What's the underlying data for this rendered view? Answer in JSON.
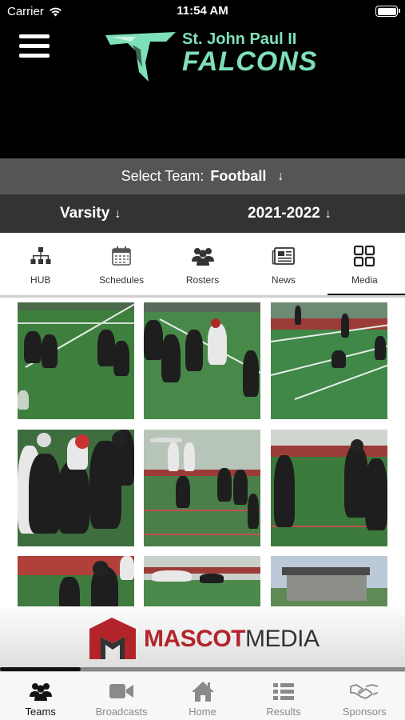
{
  "status_bar": {
    "carrier": "Carrier",
    "time": "11:54 AM"
  },
  "header": {
    "logo_school": "St. John Paul II",
    "logo_team": "FALCONS",
    "accent_color": "#7ee0b8"
  },
  "select_team": {
    "label": "Select Team:",
    "value": "Football"
  },
  "filters": {
    "level": "Varsity",
    "season": "2021-2022"
  },
  "tabs": [
    {
      "label": "HUB",
      "icon": "hierarchy-icon"
    },
    {
      "label": "Schedules",
      "icon": "calendar-icon"
    },
    {
      "label": "Rosters",
      "icon": "group-icon"
    },
    {
      "label": "News",
      "icon": "newspaper-icon"
    },
    {
      "label": "Media",
      "icon": "grid-icon",
      "active": true
    }
  ],
  "sponsor": {
    "word_a": "MASCOT",
    "word_b": "MEDIA",
    "carousel_progress": 0.2
  },
  "bottom_nav": [
    {
      "label": "Teams",
      "icon": "teams-icon",
      "active": true
    },
    {
      "label": "Broadcasts",
      "icon": "video-camera-icon"
    },
    {
      "label": "Home",
      "icon": "home-icon"
    },
    {
      "label": "Results",
      "icon": "list-icon"
    },
    {
      "label": "Sponsors",
      "icon": "handshake-icon"
    }
  ]
}
